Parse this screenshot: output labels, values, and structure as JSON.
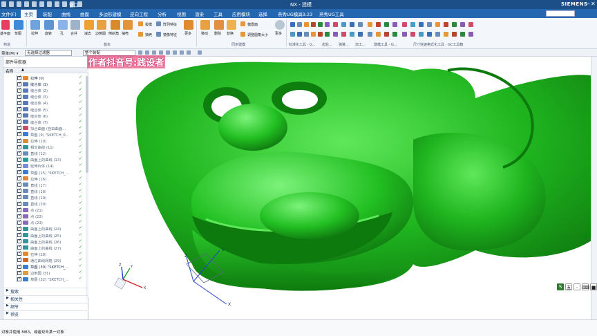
{
  "window": {
    "title": "NX - 建模",
    "brand": "SIEMENS",
    "quick_access_extra": "窗口 -",
    "minimize": "—",
    "maximize": "❐",
    "close": "✕"
  },
  "menu": {
    "file": "文件(F)",
    "tabs": [
      "主页",
      "装配",
      "曲线",
      "曲面",
      "多边形建模",
      "逆向工程",
      "分析",
      "视图",
      "渲染",
      "工具",
      "应用模块",
      "选择",
      "燕秀UG模具9.23",
      "燕秀UG工具"
    ],
    "active_tab": "主页"
  },
  "ribbon": {
    "row_labels": [
      "草图",
      "拉伸",
      "旋转",
      "孔",
      "合并",
      "减去",
      "边倒圆",
      "倒斜角",
      "更多",
      "移动",
      "删除",
      "替换",
      "更多"
    ],
    "small_labels": [
      "拔模",
      "阵列特征",
      "抽壳",
      "镜像特征",
      "偏置面",
      "调整圆角大小"
    ],
    "group_labels": [
      "构造",
      "基本",
      "同步建模",
      "标准化工具 - G...",
      "齿轮...",
      "弹簧...",
      "加工...",
      "建模工具 - G...",
      "尺寸快速格式化工具 - GC工具箱"
    ]
  },
  "toolbar2": {
    "menu_label": "菜单(M) ▾",
    "filter_label": "无选择过滤器",
    "assembly_label": "整个装配",
    "watermark": "作者抖音号:践设者"
  },
  "navigator": {
    "title": "部件导航器",
    "column": "名称",
    "items": [
      {
        "name": "拉伸 (0)",
        "icon": "extrude-icon",
        "state": "active"
      },
      {
        "name": "缝合体 (1)",
        "icon": "sew-icon",
        "state": "active"
      },
      {
        "name": "缝合体 (2)",
        "icon": "sew-icon",
        "state": "dim"
      },
      {
        "name": "缝合体 (3)",
        "icon": "sew-icon",
        "state": "dim"
      },
      {
        "name": "缝合体 (4)",
        "icon": "sew-icon",
        "state": "dim"
      },
      {
        "name": "缝合体 (5)",
        "icon": "sew-icon",
        "state": "dim"
      },
      {
        "name": "缝合体 (6)",
        "icon": "sew-icon",
        "state": "dim"
      },
      {
        "name": "缝合体 (7)",
        "icon": "sew-icon",
        "state": "dim"
      },
      {
        "name": "拟合曲面 (自由曲面...",
        "icon": "fit-surface-icon",
        "state": "dim"
      },
      {
        "name": "草图 (9) \"SKETCH_0...",
        "icon": "sketch-icon",
        "state": "dim"
      },
      {
        "name": "拉伸 (10)",
        "icon": "extrude-icon",
        "state": "dim"
      },
      {
        "name": "相交曲线 (11)",
        "icon": "curve-icon",
        "state": "dim"
      },
      {
        "name": "直线 (12)",
        "icon": "line-icon",
        "state": "dim"
      },
      {
        "name": "曲面上的曲线 (13)",
        "icon": "curve-icon",
        "state": "dim"
      },
      {
        "name": "延伸片体 (14)",
        "icon": "extend-icon",
        "state": "dim"
      },
      {
        "name": "草图 (15) \"SKETCH_...",
        "icon": "sketch-icon",
        "state": "dim"
      },
      {
        "name": "拉伸 (16)",
        "icon": "extrude-icon",
        "state": "dim"
      },
      {
        "name": "直线 (17)",
        "icon": "line-icon",
        "state": "dim"
      },
      {
        "name": "直线 (18)",
        "icon": "line-icon",
        "state": "dim"
      },
      {
        "name": "直线 (19)",
        "icon": "line-icon",
        "state": "dim"
      },
      {
        "name": "直线 (20)",
        "icon": "line-icon",
        "state": "dim"
      },
      {
        "name": "点 (21)",
        "icon": "point-icon",
        "state": "dim"
      },
      {
        "name": "点 (22)",
        "icon": "point-icon",
        "state": "dim"
      },
      {
        "name": "点 (23)",
        "icon": "point-icon",
        "state": "dim"
      },
      {
        "name": "曲面上的曲线 (24)",
        "icon": "curve-icon",
        "state": "dim"
      },
      {
        "name": "曲面上的曲线 (25)",
        "icon": "curve-icon",
        "state": "dim"
      },
      {
        "name": "曲面上的曲线 (26)",
        "icon": "curve-icon",
        "state": "dim"
      },
      {
        "name": "曲面上的曲线 (27)",
        "icon": "curve-icon",
        "state": "dim"
      },
      {
        "name": "拉伸 (28)",
        "icon": "extrude-icon",
        "state": "dim"
      },
      {
        "name": "通过曲线网格 (29)",
        "icon": "mesh-surface-icon",
        "state": "dim"
      },
      {
        "name": "草图 (30) \"SKETCH_...",
        "icon": "sketch-icon",
        "state": "active"
      },
      {
        "name": "边倒圆 (31)",
        "icon": "blend-icon",
        "state": "dim"
      },
      {
        "name": "草图 (32) \"SKETCH_...",
        "icon": "sketch-icon",
        "state": "dim"
      }
    ],
    "sections": [
      "搜索",
      "相关性",
      "细节",
      "预览"
    ]
  },
  "status": {
    "message": "对象并使用 MB3，或者双击某一对象"
  },
  "triad": {
    "x": "X",
    "y": "Y",
    "z": "Z"
  },
  "ime": [
    "S",
    "五",
    "·",
    "⌨",
    "■"
  ],
  "colors": {
    "titlebar": "#1c4f87",
    "menubar": "#2367b1",
    "model_green": "#1fb51f",
    "ok_green": "#1aa01a"
  }
}
